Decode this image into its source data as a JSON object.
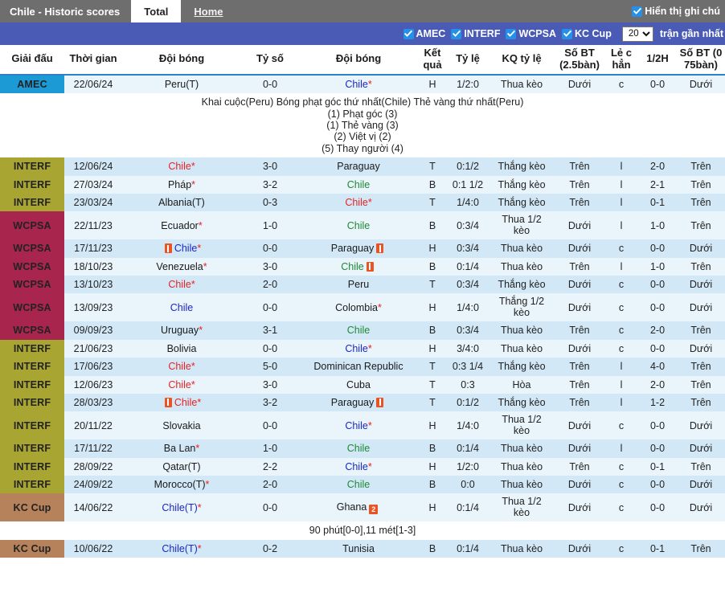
{
  "topnav": {
    "title": "Chile - Historic scores",
    "tabs": [
      {
        "label": "Total",
        "active": true
      },
      {
        "label": "Home",
        "active": false
      }
    ],
    "show_notes_label": "Hiển thị ghi chú",
    "show_notes_checked": true
  },
  "filterbar": {
    "leagues": [
      {
        "label": "AMEC",
        "checked": true
      },
      {
        "label": "INTERF",
        "checked": true
      },
      {
        "label": "WCPSA",
        "checked": true
      },
      {
        "label": "KC Cup",
        "checked": true
      }
    ],
    "count_value": "20",
    "count_options": [
      "10",
      "20",
      "30",
      "50"
    ],
    "count_suffix": "trận gần nhất"
  },
  "table": {
    "headers": [
      "Giải đấu",
      "Thời gian",
      "Đội bóng",
      "Tỷ số",
      "Đội bóng",
      "Kết quả",
      "Tỷ lệ",
      "KQ tỷ lệ",
      "Số BT (2.5bàn)",
      "Lẻ c hẳn",
      "1/2H",
      "Số BT (0 75bàn)"
    ],
    "league_colors": {
      "AMEC": "#1b9ad6",
      "INTERF": "#a9a532",
      "WCPSA": "#a8264d",
      "KC Cup": "#b5825c"
    },
    "rows": [
      {
        "league": "AMEC",
        "date": "22/06/24",
        "home": "Peru(T)",
        "home_star": false,
        "home_card": 0,
        "home_color": "black",
        "score": "0-0",
        "score_color": "blue",
        "away": "Chile",
        "away_star": true,
        "away_card": 0,
        "away_color": "blue",
        "result": "H",
        "result_color": "blue",
        "handicap": "1/2:0",
        "handicap_color": "blue",
        "handicap_result": "Thua kèo",
        "handicap_result_color": "green",
        "ou25": "Dưới",
        "ou25_color": "green",
        "oddeven": "c",
        "oddeven_color": "red",
        "half": "0-0",
        "half_color": "black",
        "ou075": "Dưới",
        "ou075_color": "green",
        "note": {
          "head": "Khai cuộc(Peru)  Bóng phạt góc thứ nhất(Chile)  Thẻ vàng thứ nhất(Peru)",
          "lines": [
            "(1) Phạt góc (3)",
            "(1) Thẻ vàng (3)",
            "(2) Việt vị (2)",
            "(5) Thay người (4)"
          ]
        }
      },
      {
        "league": "INTERF",
        "date": "12/06/24",
        "home": "Chile",
        "home_star": true,
        "home_card": 0,
        "home_color": "red",
        "score": "3-0",
        "score_color": "red",
        "away": "Paraguay",
        "away_star": false,
        "away_card": 0,
        "away_color": "black",
        "result": "T",
        "result_color": "red",
        "handicap": "0:1/2",
        "handicap_color": "blue",
        "handicap_result": "Thắng kèo",
        "handicap_result_color": "red",
        "ou25": "Trên",
        "ou25_color": "red",
        "oddeven": "l",
        "oddeven_color": "green",
        "half": "2-0",
        "half_color": "black",
        "ou075": "Trên",
        "ou075_color": "red",
        "note": null
      },
      {
        "league": "INTERF",
        "date": "27/03/24",
        "home": "Pháp",
        "home_star": true,
        "home_card": 0,
        "home_color": "black",
        "score": "3-2",
        "score_color": "red",
        "away": "Chile",
        "away_star": false,
        "away_card": 0,
        "away_color": "green",
        "result": "B",
        "result_color": "green",
        "handicap": "0:1 1/2",
        "handicap_color": "blue",
        "handicap_result": "Thắng kèo",
        "handicap_result_color": "red",
        "ou25": "Trên",
        "ou25_color": "red",
        "oddeven": "l",
        "oddeven_color": "green",
        "half": "2-1",
        "half_color": "black",
        "ou075": "Trên",
        "ou075_color": "red",
        "note": null
      },
      {
        "league": "INTERF",
        "date": "23/03/24",
        "home": "Albania(T)",
        "home_star": false,
        "home_card": 0,
        "home_color": "black",
        "score": "0-3",
        "score_color": "blue",
        "away": "Chile",
        "away_star": true,
        "away_card": 0,
        "away_color": "red",
        "result": "T",
        "result_color": "red",
        "handicap": "1/4:0",
        "handicap_color": "blue",
        "handicap_result": "Thắng kèo",
        "handicap_result_color": "red",
        "ou25": "Trên",
        "ou25_color": "red",
        "oddeven": "l",
        "oddeven_color": "green",
        "half": "0-1",
        "half_color": "black",
        "ou075": "Trên",
        "ou075_color": "red",
        "note": null
      },
      {
        "league": "WCPSA",
        "date": "22/11/23",
        "home": "Ecuador",
        "home_star": true,
        "home_card": 0,
        "home_color": "black",
        "score": "1-0",
        "score_color": "red",
        "away": "Chile",
        "away_star": false,
        "away_card": 0,
        "away_color": "green",
        "result": "B",
        "result_color": "green",
        "handicap": "0:3/4",
        "handicap_color": "blue",
        "handicap_result": "Thua 1/2 kèo",
        "handicap_result_color": "green",
        "ou25": "Dưới",
        "ou25_color": "green",
        "oddeven": "l",
        "oddeven_color": "green",
        "half": "1-0",
        "half_color": "black",
        "ou075": "Trên",
        "ou075_color": "red",
        "note": null
      },
      {
        "league": "WCPSA",
        "date": "17/11/23",
        "home": "Chile",
        "home_star": true,
        "home_card": 1,
        "home_card_pos": "before",
        "home_color": "blue",
        "score": "0-0",
        "score_color": "blue",
        "away": "Paraguay",
        "away_star": false,
        "away_card": 1,
        "away_card_pos": "after",
        "away_color": "black",
        "result": "H",
        "result_color": "blue",
        "handicap": "0:3/4",
        "handicap_color": "blue",
        "handicap_result": "Thua kèo",
        "handicap_result_color": "green",
        "ou25": "Dưới",
        "ou25_color": "green",
        "oddeven": "c",
        "oddeven_color": "red",
        "half": "0-0",
        "half_color": "black",
        "ou075": "Dưới",
        "ou075_color": "green",
        "note": null
      },
      {
        "league": "WCPSA",
        "date": "18/10/23",
        "home": "Venezuela",
        "home_star": true,
        "home_card": 0,
        "home_color": "black",
        "score": "3-0",
        "score_color": "red",
        "away": "Chile",
        "away_star": false,
        "away_card": 1,
        "away_card_pos": "after",
        "away_color": "green",
        "result": "B",
        "result_color": "green",
        "handicap": "0:1/4",
        "handicap_color": "blue",
        "handicap_result": "Thua kèo",
        "handicap_result_color": "green",
        "ou25": "Trên",
        "ou25_color": "red",
        "oddeven": "l",
        "oddeven_color": "green",
        "half": "1-0",
        "half_color": "black",
        "ou075": "Trên",
        "ou075_color": "red",
        "note": null
      },
      {
        "league": "WCPSA",
        "date": "13/10/23",
        "home": "Chile",
        "home_star": true,
        "home_card": 0,
        "home_color": "red",
        "score": "2-0",
        "score_color": "red",
        "away": "Peru",
        "away_star": false,
        "away_card": 0,
        "away_color": "black",
        "result": "T",
        "result_color": "red",
        "handicap": "0:3/4",
        "handicap_color": "blue",
        "handicap_result": "Thắng kèo",
        "handicap_result_color": "red",
        "ou25": "Dưới",
        "ou25_color": "green",
        "oddeven": "c",
        "oddeven_color": "red",
        "half": "0-0",
        "half_color": "black",
        "ou075": "Dưới",
        "ou075_color": "green",
        "note": null
      },
      {
        "league": "WCPSA",
        "date": "13/09/23",
        "home": "Chile",
        "home_star": false,
        "home_card": 0,
        "home_color": "blue",
        "score": "0-0",
        "score_color": "blue",
        "away": "Colombia",
        "away_star": true,
        "away_card": 0,
        "away_color": "black",
        "result": "H",
        "result_color": "blue",
        "handicap": "1/4:0",
        "handicap_color": "blue",
        "handicap_result": "Thắng 1/2 kèo",
        "handicap_result_color": "red",
        "ou25": "Dưới",
        "ou25_color": "green",
        "oddeven": "c",
        "oddeven_color": "red",
        "half": "0-0",
        "half_color": "black",
        "ou075": "Dưới",
        "ou075_color": "green",
        "note": null
      },
      {
        "league": "WCPSA",
        "date": "09/09/23",
        "home": "Uruguay",
        "home_star": true,
        "home_card": 0,
        "home_color": "black",
        "score": "3-1",
        "score_color": "red",
        "away": "Chile",
        "away_star": false,
        "away_card": 0,
        "away_color": "green",
        "result": "B",
        "result_color": "green",
        "handicap": "0:3/4",
        "handicap_color": "blue",
        "handicap_result": "Thua kèo",
        "handicap_result_color": "green",
        "ou25": "Trên",
        "ou25_color": "red",
        "oddeven": "c",
        "oddeven_color": "red",
        "half": "2-0",
        "half_color": "black",
        "ou075": "Trên",
        "ou075_color": "red",
        "note": null
      },
      {
        "league": "INTERF",
        "date": "21/06/23",
        "home": "Bolivia",
        "home_star": false,
        "home_card": 0,
        "home_color": "black",
        "score": "0-0",
        "score_color": "blue",
        "away": "Chile",
        "away_star": true,
        "away_card": 0,
        "away_color": "blue",
        "result": "H",
        "result_color": "blue",
        "handicap": "3/4:0",
        "handicap_color": "blue",
        "handicap_result": "Thua kèo",
        "handicap_result_color": "green",
        "ou25": "Dưới",
        "ou25_color": "green",
        "oddeven": "c",
        "oddeven_color": "red",
        "half": "0-0",
        "half_color": "black",
        "ou075": "Dưới",
        "ou075_color": "green",
        "note": null
      },
      {
        "league": "INTERF",
        "date": "17/06/23",
        "home": "Chile",
        "home_star": true,
        "home_card": 0,
        "home_color": "red",
        "score": "5-0",
        "score_color": "red",
        "away": "Dominican Republic",
        "away_star": false,
        "away_card": 0,
        "away_color": "black",
        "result": "T",
        "result_color": "red",
        "handicap": "0:3 1/4",
        "handicap_color": "blue",
        "handicap_result": "Thắng kèo",
        "handicap_result_color": "red",
        "ou25": "Trên",
        "ou25_color": "red",
        "oddeven": "l",
        "oddeven_color": "green",
        "half": "4-0",
        "half_color": "black",
        "ou075": "Trên",
        "ou075_color": "red",
        "note": null
      },
      {
        "league": "INTERF",
        "date": "12/06/23",
        "home": "Chile",
        "home_star": true,
        "home_card": 0,
        "home_color": "red",
        "score": "3-0",
        "score_color": "red",
        "away": "Cuba",
        "away_star": false,
        "away_card": 0,
        "away_color": "black",
        "result": "T",
        "result_color": "red",
        "handicap": "0:3",
        "handicap_color": "blue",
        "handicap_result": "Hòa",
        "handicap_result_color": "blue",
        "ou25": "Trên",
        "ou25_color": "red",
        "oddeven": "l",
        "oddeven_color": "green",
        "half": "2-0",
        "half_color": "black",
        "ou075": "Trên",
        "ou075_color": "red",
        "note": null
      },
      {
        "league": "INTERF",
        "date": "28/03/23",
        "home": "Chile",
        "home_star": true,
        "home_card": 1,
        "home_card_pos": "before",
        "home_color": "red",
        "score": "3-2",
        "score_color": "red",
        "away": "Paraguay",
        "away_star": false,
        "away_card": 1,
        "away_card_pos": "after",
        "away_color": "black",
        "result": "T",
        "result_color": "red",
        "handicap": "0:1/2",
        "handicap_color": "blue",
        "handicap_result": "Thắng kèo",
        "handicap_result_color": "red",
        "ou25": "Trên",
        "ou25_color": "red",
        "oddeven": "l",
        "oddeven_color": "green",
        "half": "1-2",
        "half_color": "black",
        "ou075": "Trên",
        "ou075_color": "red",
        "note": null
      },
      {
        "league": "INTERF",
        "date": "20/11/22",
        "home": "Slovakia",
        "home_star": false,
        "home_card": 0,
        "home_color": "black",
        "score": "0-0",
        "score_color": "blue",
        "away": "Chile",
        "away_star": true,
        "away_card": 0,
        "away_color": "blue",
        "result": "H",
        "result_color": "blue",
        "handicap": "1/4:0",
        "handicap_color": "blue",
        "handicap_result": "Thua 1/2 kèo",
        "handicap_result_color": "green",
        "ou25": "Dưới",
        "ou25_color": "green",
        "oddeven": "c",
        "oddeven_color": "red",
        "half": "0-0",
        "half_color": "black",
        "ou075": "Dưới",
        "ou075_color": "green",
        "note": null
      },
      {
        "league": "INTERF",
        "date": "17/11/22",
        "home": "Ba Lan",
        "home_star": true,
        "home_card": 0,
        "home_color": "black",
        "score": "1-0",
        "score_color": "red",
        "away": "Chile",
        "away_star": false,
        "away_card": 0,
        "away_color": "green",
        "result": "B",
        "result_color": "green",
        "handicap": "0:1/4",
        "handicap_color": "blue",
        "handicap_result": "Thua kèo",
        "handicap_result_color": "green",
        "ou25": "Dưới",
        "ou25_color": "green",
        "oddeven": "l",
        "oddeven_color": "green",
        "half": "0-0",
        "half_color": "black",
        "ou075": "Dưới",
        "ou075_color": "green",
        "note": null
      },
      {
        "league": "INTERF",
        "date": "28/09/22",
        "home": "Qatar(T)",
        "home_star": false,
        "home_card": 0,
        "home_color": "black",
        "score": "2-2",
        "score_color": "red",
        "away": "Chile",
        "away_star": true,
        "away_card": 0,
        "away_color": "blue",
        "result": "H",
        "result_color": "blue",
        "handicap": "1/2:0",
        "handicap_color": "blue",
        "handicap_result": "Thua kèo",
        "handicap_result_color": "green",
        "ou25": "Trên",
        "ou25_color": "red",
        "oddeven": "c",
        "oddeven_color": "red",
        "half": "0-1",
        "half_color": "black",
        "ou075": "Trên",
        "ou075_color": "red",
        "note": null
      },
      {
        "league": "INTERF",
        "date": "24/09/22",
        "home": "Morocco(T)",
        "home_star": true,
        "home_card": 0,
        "home_color": "black",
        "score": "2-0",
        "score_color": "red",
        "away": "Chile",
        "away_star": false,
        "away_card": 0,
        "away_color": "green",
        "result": "B",
        "result_color": "green",
        "handicap": "0:0",
        "handicap_color": "blue",
        "handicap_result": "Thua kèo",
        "handicap_result_color": "green",
        "ou25": "Dưới",
        "ou25_color": "green",
        "oddeven": "c",
        "oddeven_color": "red",
        "half": "0-0",
        "half_color": "black",
        "ou075": "Dưới",
        "ou075_color": "green",
        "note": null
      },
      {
        "league": "KC Cup",
        "date": "14/06/22",
        "home": "Chile(T)",
        "home_star": true,
        "home_card": 0,
        "home_color": "blue",
        "score": "0-0",
        "score_color": "blue",
        "away": "Ghana",
        "away_star": false,
        "away_card": 2,
        "away_card_pos": "after",
        "away_color": "black",
        "result": "H",
        "result_color": "blue",
        "handicap": "0:1/4",
        "handicap_color": "blue",
        "handicap_result": "Thua 1/2 kèo",
        "handicap_result_color": "green",
        "ou25": "Dưới",
        "ou25_color": "green",
        "oddeven": "c",
        "oddeven_color": "red",
        "half": "0-0",
        "half_color": "black",
        "ou075": "Dưới",
        "ou075_color": "green",
        "note": {
          "head": "90 phút[0-0],11 mét[1-3]",
          "lines": []
        }
      },
      {
        "league": "KC Cup",
        "date": "10/06/22",
        "home": "Chile(T)",
        "home_star": true,
        "home_card": 0,
        "home_color": "blue",
        "score": "0-2",
        "score_color": "blue",
        "away": "Tunisia",
        "away_star": false,
        "away_card": 0,
        "away_color": "black",
        "result": "B",
        "result_color": "green",
        "handicap": "0:1/4",
        "handicap_color": "blue",
        "handicap_result": "Thua kèo",
        "handicap_result_color": "green",
        "ou25": "Dưới",
        "ou25_color": "green",
        "oddeven": "c",
        "oddeven_color": "red",
        "half": "0-1",
        "half_color": "black",
        "ou075": "Trên",
        "ou075_color": "red",
        "note": null
      }
    ]
  }
}
